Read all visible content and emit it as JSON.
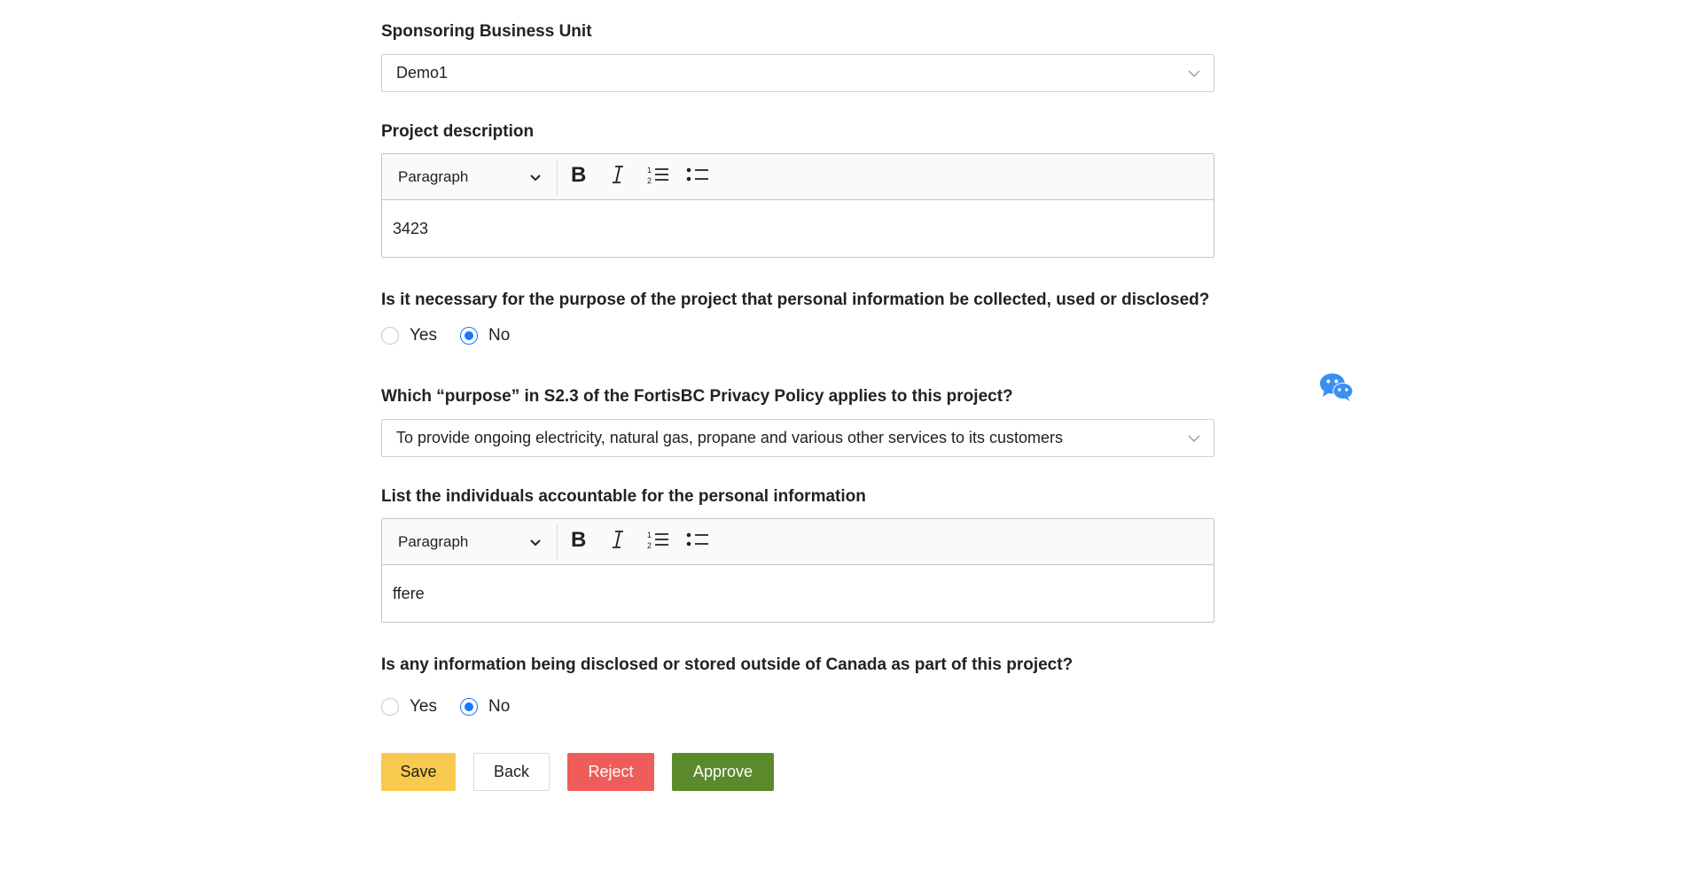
{
  "sponsoring_unit": {
    "label": "Sponsoring Business Unit",
    "value": "Demo1"
  },
  "project_description": {
    "label": "Project description",
    "block_format": "Paragraph",
    "content": "3423"
  },
  "pi_necessary": {
    "question": "Is it necessary for the purpose of the project that personal information be collected, used or disclosed?",
    "options": [
      "Yes",
      "No"
    ],
    "selected": "No"
  },
  "purpose": {
    "label": "Which “purpose” in S2.3 of the FortisBC Privacy Policy applies to this project?",
    "value": "To provide ongoing electricity, natural gas, propane and various other services to its customers"
  },
  "accountable": {
    "label": "List the individuals accountable for the personal information",
    "block_format": "Paragraph",
    "content": "ffere"
  },
  "outside_canada": {
    "question": "Is any information being disclosed or stored outside of Canada as part of this project?",
    "options": [
      "Yes",
      "No"
    ],
    "selected": "No"
  },
  "actions": {
    "save": "Save",
    "back": "Back",
    "reject": "Reject",
    "approve": "Approve"
  },
  "colors": {
    "save": "#f7c94e",
    "reject": "#ef5d5b",
    "approve": "#5a8a2b",
    "radio_checked": "#1677ff",
    "chat_icon": "#3b8ff0"
  },
  "icons": {
    "chat": "wechat-icon",
    "bold": "bold-icon",
    "italic": "italic-icon",
    "numbered_list": "numbered-list-icon",
    "bulleted_list": "bulleted-list-icon"
  }
}
